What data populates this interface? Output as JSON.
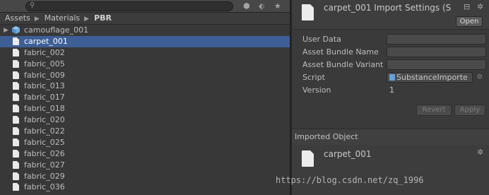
{
  "toolbar": {
    "search_value": "",
    "icons": [
      "search-icon",
      "filter-by-type-icon",
      "filter-by-label-icon",
      "favorite-star-icon"
    ],
    "filter_type_glyph": "⬢",
    "filter_label_glyph": "⬖",
    "star_glyph": "★",
    "search_glyph": "⚲"
  },
  "breadcrumb": {
    "items": [
      "Assets",
      "Materials",
      "PBR"
    ],
    "separator": "▶"
  },
  "project": {
    "files": [
      {
        "name": "camouflage_001",
        "icon": "substance-cube-icon",
        "expandable": true,
        "selected": false
      },
      {
        "name": "carpet_001",
        "icon": "file-icon",
        "expandable": false,
        "selected": true
      },
      {
        "name": "fabric_002",
        "icon": "file-icon",
        "expandable": false,
        "selected": false
      },
      {
        "name": "fabric_005",
        "icon": "file-icon",
        "expandable": false,
        "selected": false
      },
      {
        "name": "fabric_009",
        "icon": "file-icon",
        "expandable": false,
        "selected": false
      },
      {
        "name": "fabric_013",
        "icon": "file-icon",
        "expandable": false,
        "selected": false
      },
      {
        "name": "fabric_017",
        "icon": "file-icon",
        "expandable": false,
        "selected": false
      },
      {
        "name": "fabric_018",
        "icon": "file-icon",
        "expandable": false,
        "selected": false
      },
      {
        "name": "fabric_020",
        "icon": "file-icon",
        "expandable": false,
        "selected": false
      },
      {
        "name": "fabric_022",
        "icon": "file-icon",
        "expandable": false,
        "selected": false
      },
      {
        "name": "fabric_025",
        "icon": "file-icon",
        "expandable": false,
        "selected": false
      },
      {
        "name": "fabric_026",
        "icon": "file-icon",
        "expandable": false,
        "selected": false
      },
      {
        "name": "fabric_027",
        "icon": "file-icon",
        "expandable": false,
        "selected": false
      },
      {
        "name": "fabric_029",
        "icon": "file-icon",
        "expandable": false,
        "selected": false
      },
      {
        "name": "fabric_036",
        "icon": "file-icon",
        "expandable": false,
        "selected": false
      }
    ],
    "selection_color": "#3e5f96"
  },
  "inspector": {
    "title": "carpet_001 Import Settings (S",
    "open_label": "Open",
    "header_icons": [
      "layout-icon",
      "gear-icon"
    ],
    "layout_glyph": "⊟",
    "gear_glyph": "✲",
    "properties": {
      "user_data_label": "User Data",
      "user_data_value": "",
      "bundle_name_label": "Asset Bundle Name",
      "bundle_name_value": "",
      "bundle_variant_label": "Asset Bundle Variant",
      "bundle_variant_value": "",
      "script_label": "Script",
      "script_value": "SubstanceImporte",
      "script_picker_glyph": "⊙",
      "version_label": "Version",
      "version_value": "1"
    },
    "revert_label": "Revert",
    "apply_label": "Apply",
    "imported_object_header": "Imported Object",
    "imported_object_name": "carpet_001"
  },
  "watermark": "https://blog.csdn.net/zq_1996"
}
